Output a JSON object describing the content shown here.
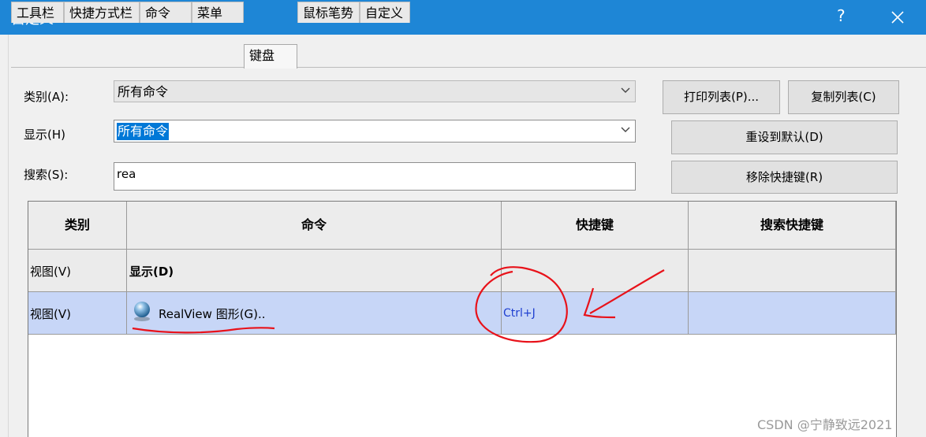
{
  "window": {
    "title": "自定义",
    "help_label": "?"
  },
  "tabs": [
    {
      "label": "工具栏"
    },
    {
      "label": "快捷方式栏"
    },
    {
      "label": "命令"
    },
    {
      "label": "菜单"
    },
    {
      "label": "键盘",
      "active": true
    },
    {
      "label": "鼠标笔势"
    },
    {
      "label": "自定义"
    }
  ],
  "form": {
    "category_label": "类别(A):",
    "category_value": "所有命令",
    "show_label": "显示(H)",
    "show_value": "所有命令",
    "search_label": "搜索(S):",
    "search_value": "rea"
  },
  "buttons": {
    "print_list": "打印列表(P)...",
    "copy_list": "复制列表(C)",
    "reset_default": "重设到默认(D)",
    "remove_shortcut": "移除快捷键(R)"
  },
  "table": {
    "headers": [
      "类别",
      "命令",
      "快捷键",
      "搜索快捷键"
    ],
    "rows": [
      {
        "category": "视图(V)",
        "command": "显示(D)",
        "shortcut": "",
        "search_shortcut": ""
      },
      {
        "category": "视图(V)",
        "command": "RealView 图形(G)..",
        "shortcut": "Ctrl+J",
        "search_shortcut": ""
      }
    ]
  },
  "watermark": "CSDN @宁静致远2021",
  "colors": {
    "titlebar": "#1e86d6",
    "selection": "#0078d7",
    "selected_row": "#c7d6f7",
    "annotation": "#e8121a",
    "shortcut_text": "#1f3fd0"
  },
  "icons": {
    "realview": "blue-sphere-icon",
    "close": "close-icon",
    "dropdown": "chevron-down-icon"
  }
}
